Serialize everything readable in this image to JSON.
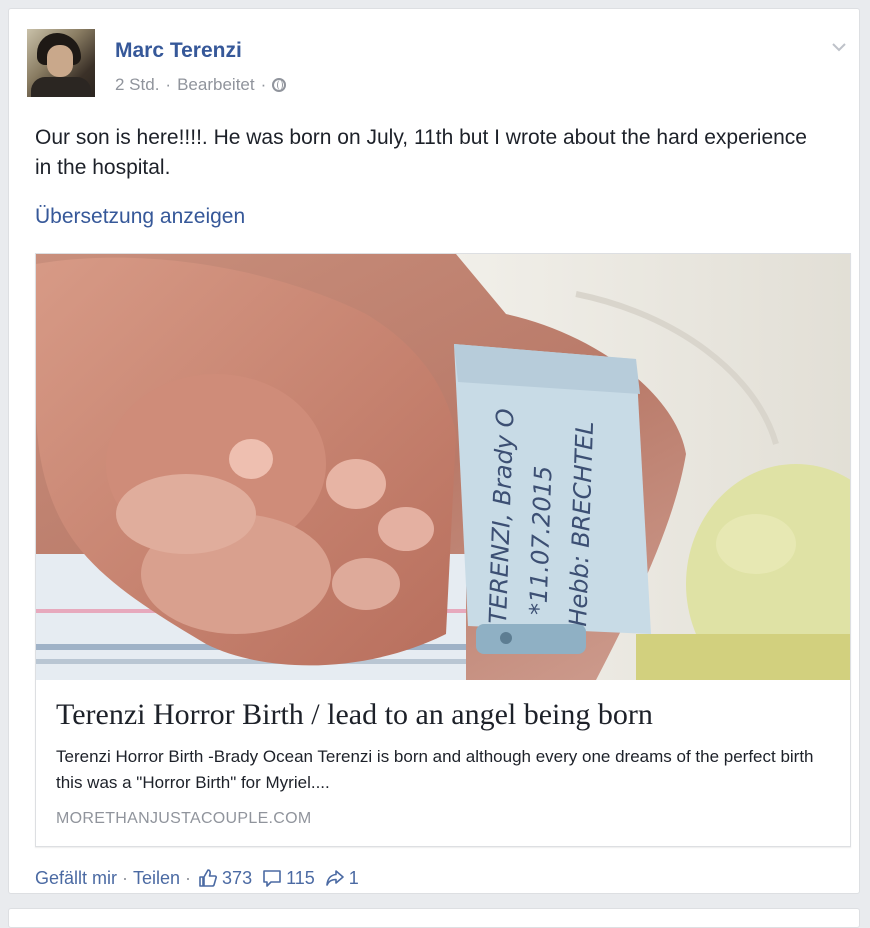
{
  "post": {
    "author": "Marc Terenzi",
    "time": "2 Std.",
    "edited": "Bearbeitet",
    "meta_sep": "·",
    "text": "Our son is here!!!!. He was born on July, 11th but I wrote about the hard experience in the hospital.",
    "translate_link": "Übersetzung anzeigen"
  },
  "attachment": {
    "title": "Terenzi Horror Birth / lead to an angel being born",
    "description": "Terenzi Horror Birth -Brady Ocean Terenzi is born and although every one dreams of the perfect birth this was a \"Horror Birth\" for Myriel....",
    "domain": "MORETHANJUSTACOUPLE.COM",
    "photo_band_text": {
      "line1": "TERENZI, Brady O",
      "line2": "*11.07.2015",
      "line3": "Hebb: BRECHTEL"
    }
  },
  "footer": {
    "like": "Gefällt mir",
    "share": "Teilen",
    "sep": "·",
    "likes_count": "373",
    "comments_count": "115",
    "shares_count": "1"
  },
  "icons": {
    "menu": "chevron-down-icon",
    "privacy": "globe-icon",
    "likes": "thumbs-up-icon",
    "comments": "comment-icon",
    "shares": "share-icon"
  },
  "colors": {
    "link_blue": "#365899",
    "meta_gray": "#90949c",
    "text": "#1d2129",
    "background": "#e9ebee"
  }
}
